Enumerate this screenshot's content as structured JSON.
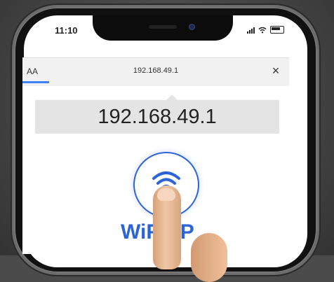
{
  "status_bar": {
    "time": "11:10",
    "icons": [
      "signal-icon",
      "wifi-icon",
      "battery-icon"
    ]
  },
  "browser": {
    "text_size_label": "AA",
    "url": "192.168.49.1",
    "close_label": "×"
  },
  "page": {
    "ip_display": "192.168.49.1",
    "wifiap_label": "WiFiAP"
  },
  "colors": {
    "accent": "#2b63d8",
    "underline": "#3b82f6"
  }
}
